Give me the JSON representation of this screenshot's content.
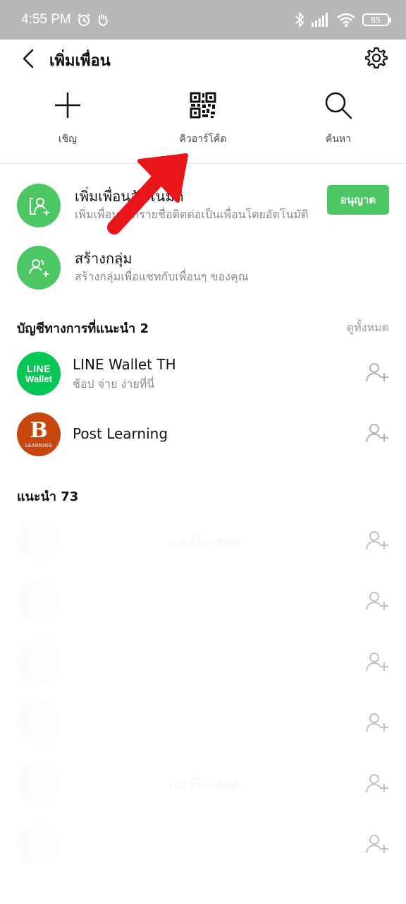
{
  "status_bar": {
    "time": "4:55 PM",
    "battery": "85"
  },
  "header": {
    "title": "เพิ่มเพื่อน",
    "back_icon": "chevron-left-icon",
    "settings_icon": "gear-icon"
  },
  "actions": [
    {
      "label": "เชิญ",
      "icon": "plus-icon"
    },
    {
      "label": "คิวอาร์โค้ด",
      "icon": "qr-code-icon"
    },
    {
      "label": "ค้นหา",
      "icon": "search-icon"
    }
  ],
  "features": {
    "auto_add": {
      "title": "เพิ่มเพื่อนอัตโนมัติ",
      "subtitle": "เพิ่มเพื่อนจากรายชื่อติดต่อเป็นเพื่อนโดยอัตโนมัติ",
      "button": "อนุญาต"
    },
    "create_group": {
      "title": "สร้างกลุ่ม",
      "subtitle": "สร้างกลุ่มเพื่อแชทกับเพื่อนๆ ของคุณ"
    }
  },
  "official": {
    "title": "บัญชีทางการที่แนะนำ 2",
    "see_all": "ดูทั้งหมด",
    "accounts": [
      {
        "name": "LINE Wallet TH",
        "subtitle": "ช้อป จ่าย ง่ายที่นี่",
        "logo_line1": "LINE",
        "logo_line2": "Wallet"
      },
      {
        "name": "Post Learning",
        "subtitle": "",
        "logo_letter": "B",
        "logo_text": "LEARNING"
      }
    ]
  },
  "suggested": {
    "title": "แนะนำ 73",
    "items": [
      {
        "text": "เบอร์โทรศัพท์"
      },
      {
        "text": ""
      },
      {
        "text": ""
      },
      {
        "text": ""
      },
      {
        "text": "เบอร์โทรศัพท์"
      },
      {
        "text": ""
      }
    ]
  },
  "colors": {
    "line_green": "#4cc764",
    "status_bar": "#b8b8b8",
    "annotation_red": "#e8151b"
  }
}
